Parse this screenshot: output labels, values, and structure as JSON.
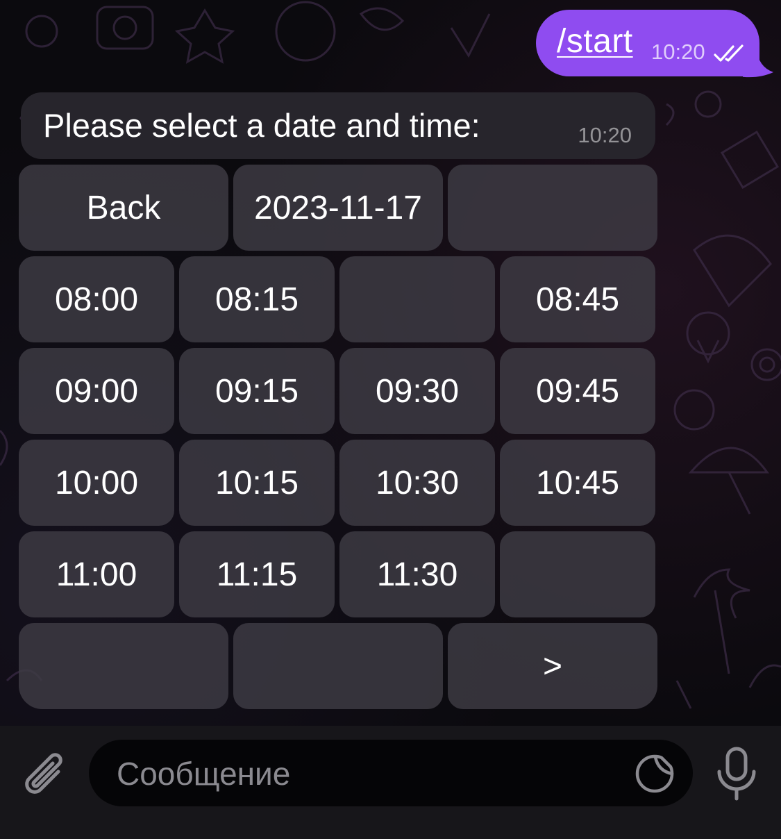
{
  "chat": {
    "outgoing": {
      "command": "/start",
      "time": "10:20",
      "status_icon": "double-check-icon",
      "bubble_color": "#8f4cf0"
    },
    "incoming": {
      "text": "Please select a date and time:",
      "time": "10:20"
    }
  },
  "keyboard": {
    "rows": [
      [
        "Back",
        "2023-11-17",
        ""
      ],
      [
        "08:00",
        "08:15",
        "",
        "08:45"
      ],
      [
        "09:00",
        "09:15",
        "09:30",
        "09:45"
      ],
      [
        "10:00",
        "10:15",
        "10:30",
        "10:45"
      ],
      [
        "11:00",
        "11:15",
        "11:30",
        ""
      ],
      [
        "",
        "",
        ">"
      ]
    ]
  },
  "composer": {
    "placeholder": "Сообщение",
    "attach_icon": "paperclip-icon",
    "sticker_icon": "sticker-icon",
    "mic_icon": "microphone-icon"
  }
}
